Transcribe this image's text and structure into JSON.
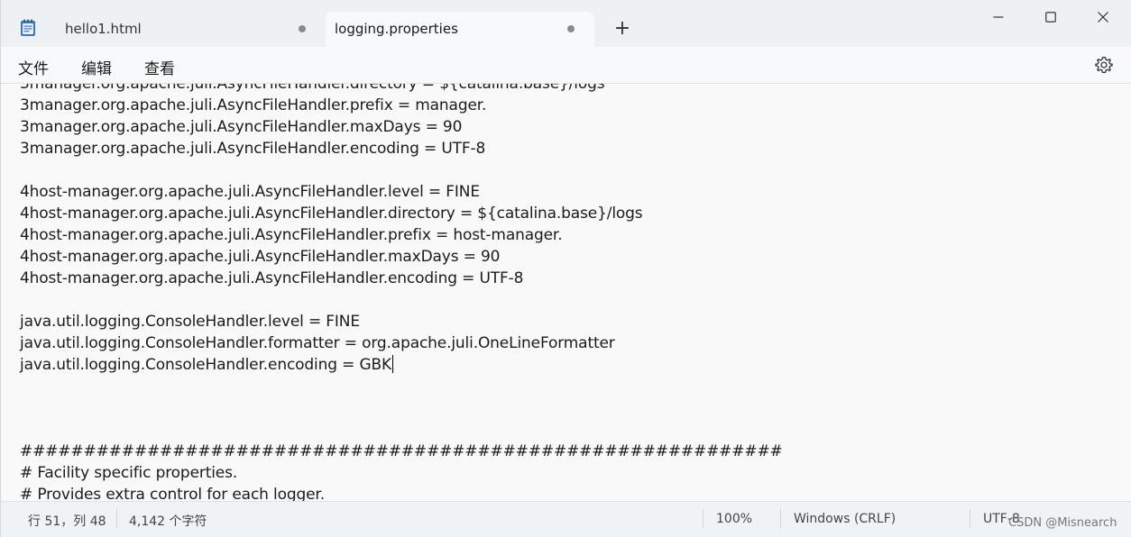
{
  "tabs": [
    {
      "label": "hello1.html"
    },
    {
      "label": "logging.properties"
    }
  ],
  "new_tab_symbol": "+",
  "menu": {
    "file": "文件",
    "edit": "编辑",
    "view": "查看"
  },
  "icons": {
    "app": "notepad-icon",
    "settings": "gear-icon",
    "minimize": "minimize-icon",
    "maximize": "maximize-icon",
    "close": "close-icon"
  },
  "editor": {
    "lines": [
      "3manager.org.apache.juli.AsyncFileHandler.directory = ${catalina.base}/logs",
      "3manager.org.apache.juli.AsyncFileHandler.prefix = manager.",
      "3manager.org.apache.juli.AsyncFileHandler.maxDays = 90",
      "3manager.org.apache.juli.AsyncFileHandler.encoding = UTF-8",
      "",
      "4host-manager.org.apache.juli.AsyncFileHandler.level = FINE",
      "4host-manager.org.apache.juli.AsyncFileHandler.directory = ${catalina.base}/logs",
      "4host-manager.org.apache.juli.AsyncFileHandler.prefix = host-manager.",
      "4host-manager.org.apache.juli.AsyncFileHandler.maxDays = 90",
      "4host-manager.org.apache.juli.AsyncFileHandler.encoding = UTF-8",
      "",
      "java.util.logging.ConsoleHandler.level = FINE",
      "java.util.logging.ConsoleHandler.formatter = org.apache.juli.OneLineFormatter",
      "java.util.logging.ConsoleHandler.encoding = GBK",
      "",
      "",
      "",
      "############################################################",
      "# Facility specific properties.",
      "# Provides extra control for each logger.",
      "############################################################"
    ],
    "caret_line": 13
  },
  "status": {
    "position": "行 51，列 48",
    "char_count": "4,142 个字符",
    "zoom": "100%",
    "line_ending": "Windows (CRLF)",
    "encoding": "UTF-8"
  },
  "watermark": "CSDN @Misnearch"
}
